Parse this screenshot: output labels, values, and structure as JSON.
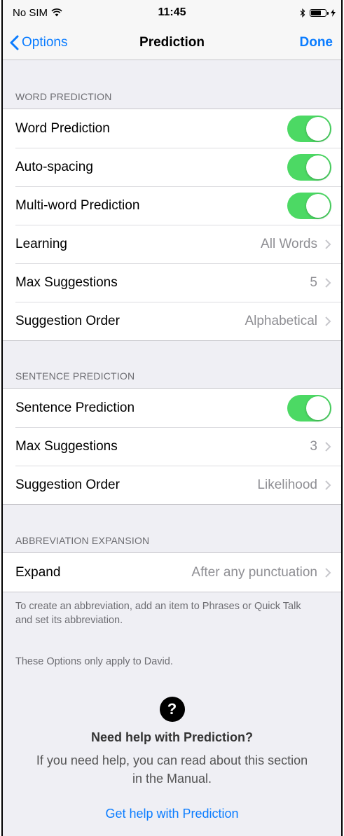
{
  "status": {
    "carrier": "No SIM",
    "time": "11:45"
  },
  "nav": {
    "back_label": "Options",
    "title": "Prediction",
    "done_label": "Done"
  },
  "word_prediction": {
    "header": "WORD PREDICTION",
    "rows": [
      {
        "label": "Word Prediction",
        "toggle": true
      },
      {
        "label": "Auto-spacing",
        "toggle": true
      },
      {
        "label": "Multi-word Prediction",
        "toggle": true
      },
      {
        "label": "Learning",
        "value": "All Words"
      },
      {
        "label": "Max Suggestions",
        "value": "5"
      },
      {
        "label": "Suggestion Order",
        "value": "Alphabetical"
      }
    ]
  },
  "sentence_prediction": {
    "header": "SENTENCE PREDICTION",
    "rows": [
      {
        "label": "Sentence Prediction",
        "toggle": true
      },
      {
        "label": "Max Suggestions",
        "value": "3"
      },
      {
        "label": "Suggestion Order",
        "value": "Likelihood"
      }
    ]
  },
  "abbreviation_expansion": {
    "header": "ABBREVIATION EXPANSION",
    "rows": [
      {
        "label": "Expand",
        "value": "After any punctuation"
      }
    ],
    "footnote": "To create an abbreviation, add an item to Phrases or Quick Talk and set its abbreviation."
  },
  "options_note": "These Options only apply to David.",
  "help": {
    "icon": "question-circle-icon",
    "icon_glyph": "?",
    "title": "Need help with Prediction?",
    "body": "If you need help, you can read about this section in the Manual.",
    "link": "Get help with Prediction"
  },
  "colors": {
    "accent": "#0a7cff",
    "toggle_on": "#4cd964",
    "background": "#efeff4",
    "secondary_text": "#8e8e93"
  }
}
